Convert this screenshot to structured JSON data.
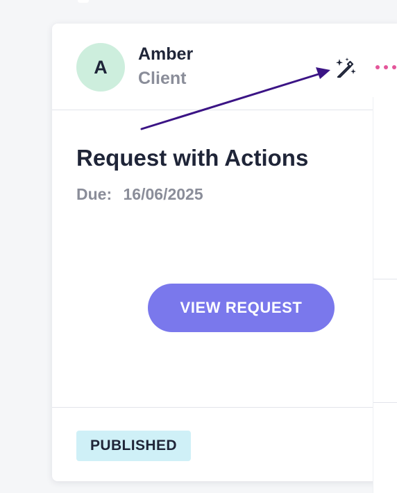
{
  "card": {
    "user": {
      "initial": "A",
      "name": "Amber",
      "role": "Client"
    },
    "header_actions": {
      "magic_icon": "magic-wand-sparkles-icon",
      "more_icon": "more-horizontal-icon"
    },
    "request": {
      "title": "Request with Actions",
      "due_label": "Due:",
      "due_date": "16/06/2025"
    },
    "view_button_label": "VIEW REQUEST",
    "status_badge": "PUBLISHED"
  },
  "colors": {
    "avatar_bg": "#cdeedd",
    "primary_button": "#7a78ec",
    "badge_bg": "#cff0f7",
    "more_dots": "#e4569a",
    "annotation_arrow": "#3b1485"
  }
}
